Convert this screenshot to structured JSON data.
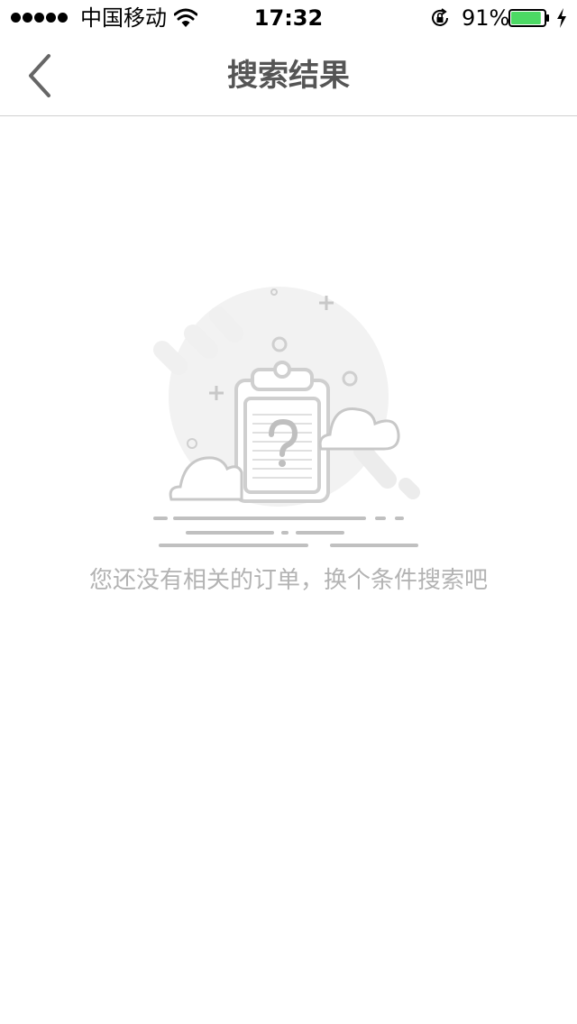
{
  "status_bar": {
    "carrier": "中国移动",
    "time": "17:32",
    "battery_percent": "91%",
    "signal_strength": 5,
    "battery_level": 0.91,
    "battery_color": "#4cd964"
  },
  "nav": {
    "title": "搜索结果",
    "back_icon": "chevron-left-icon"
  },
  "empty_state": {
    "illustration_icon": "empty-clipboard-question-icon",
    "message": "您还没有相关的订单，换个条件搜索吧"
  },
  "colors": {
    "title_text": "#555555",
    "message_text": "#b3b3b3",
    "illustration_stroke": "#c8c8c8",
    "illustration_bg": "#f2f2f2"
  }
}
